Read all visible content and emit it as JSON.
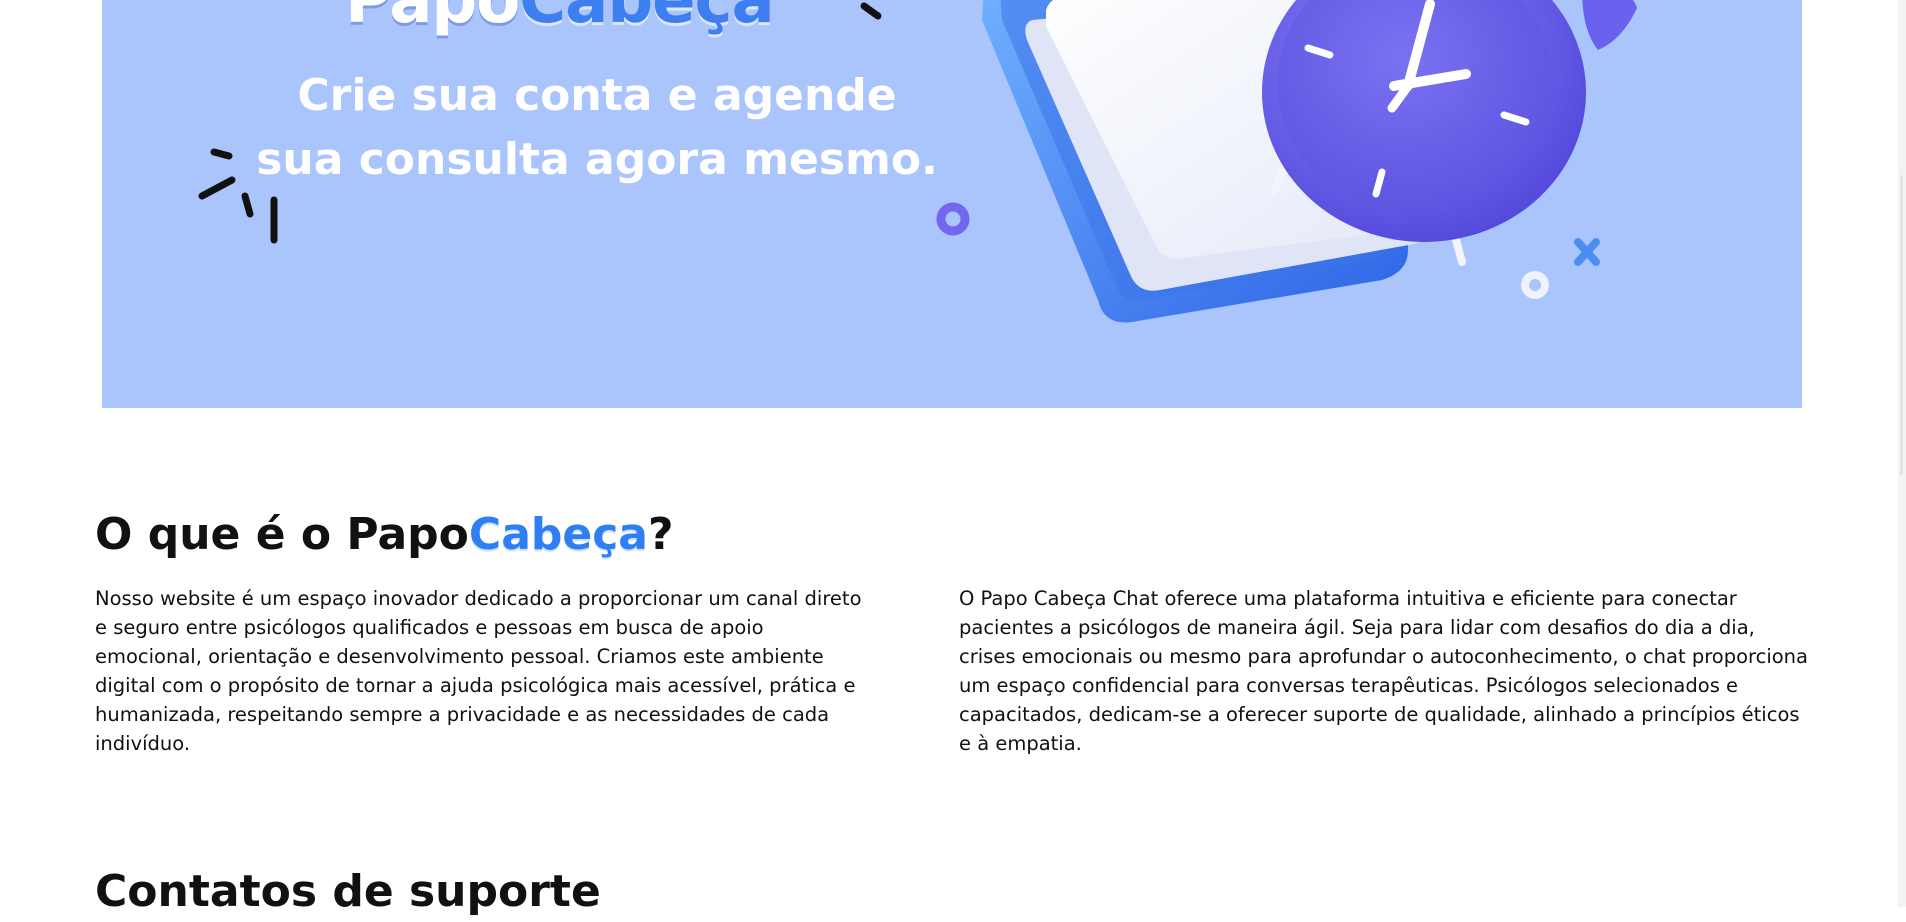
{
  "hero": {
    "brand_part1": "Papo",
    "brand_part2": "Cabeça",
    "tagline_line1": "Crie sua conta e agende",
    "tagline_line2": "sua consulta agora mesmo.",
    "background_color": "#aac4fc",
    "illustration": "calendar-and-alarm-clock"
  },
  "about": {
    "title_prefix": "O que é o Papo",
    "title_accent": "Cabeça",
    "title_suffix": "?",
    "paragraph_left": "Nosso website é um espaço inovador dedicado a proporcionar um canal direto e seguro entre psicólogos qualificados e pessoas em busca de apoio emocional, orientação e desenvolvimento pessoal. Criamos este ambiente digital com o propósito de tornar a ajuda psicológica mais acessível, prática e humanizada, respeitando sempre a privacidade e as necessidades de cada indivíduo.",
    "paragraph_right": "O Papo Cabeça Chat oferece uma plataforma intuitiva e eficiente para conectar pacientes a psicólogos de maneira ágil. Seja para lidar com desafios do dia a dia, crises emocionais ou mesmo para aprofundar o autoconhecimento, o chat proporciona um espaço confidencial para conversas terapêuticas. Psicólogos selecionados e capacitados, dedicam-se a oferecer suporte de qualidade, alinhado a princípios éticos e à empatia.",
    "accent_color": "#2e80f2"
  },
  "support": {
    "title": "Contatos de suporte"
  }
}
